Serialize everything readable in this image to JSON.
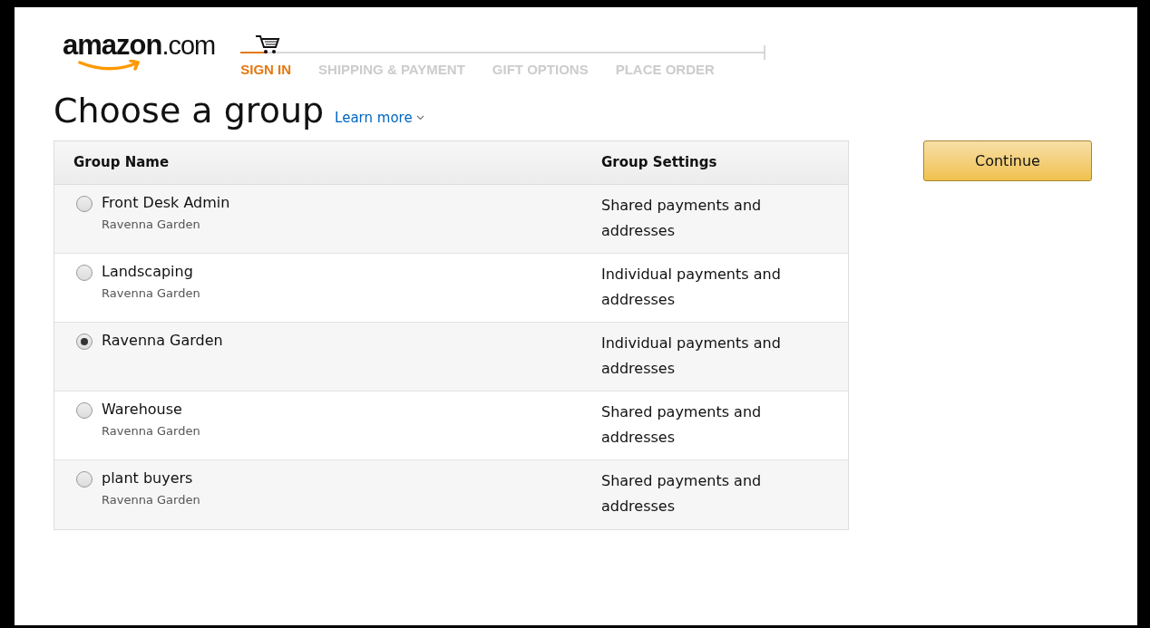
{
  "logo": {
    "text": "amazon",
    "suffix": ".com"
  },
  "steps": [
    {
      "label": "SIGN IN",
      "selected": true
    },
    {
      "label": "SHIPPING & PAYMENT",
      "selected": false
    },
    {
      "label": "GIFT OPTIONS",
      "selected": false
    },
    {
      "label": "PLACE ORDER",
      "selected": false
    }
  ],
  "heading": "Choose a group",
  "learn_more": "Learn more",
  "table": {
    "columns": [
      "Group Name",
      "Group Settings"
    ],
    "rows": [
      {
        "name": "Front Desk Admin",
        "parent": "Ravenna Garden",
        "settings": "Shared payments and addresses",
        "selected": false
      },
      {
        "name": "Landscaping",
        "parent": "Ravenna Garden",
        "settings": "Individual payments and addresses",
        "selected": false
      },
      {
        "name": "Ravenna Garden",
        "settings": "Individual payments and addresses",
        "selected": true
      },
      {
        "name": "Warehouse",
        "parent": "Ravenna Garden",
        "settings": "Shared payments and addresses",
        "selected": false
      },
      {
        "name": "plant buyers",
        "parent": "Ravenna Garden",
        "settings": "Shared payments and addresses",
        "selected": false
      }
    ]
  },
  "continue_button": "Continue"
}
